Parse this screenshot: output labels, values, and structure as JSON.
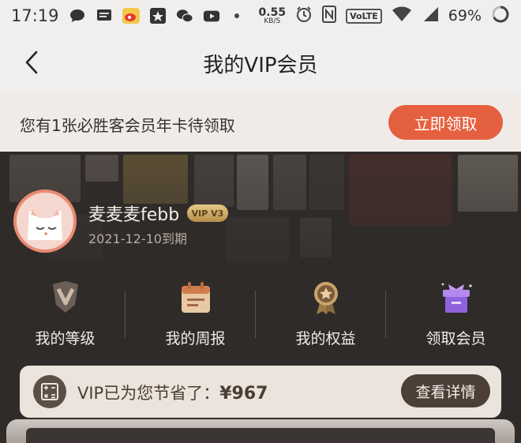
{
  "status_bar": {
    "time": "17:19",
    "net_speed_value": "0.55",
    "net_speed_unit": "KB/S",
    "volte": "VoLTE",
    "battery": "69%",
    "icons": [
      "chat-bubble-icon",
      "message-icon",
      "weibo-icon",
      "star-app-icon",
      "wechat-icon",
      "youtube-icon",
      "alarm-icon",
      "nfc-icon",
      "wifi-icon",
      "signal-icon",
      "battery-ring-icon"
    ]
  },
  "nav": {
    "title": "我的VIP会员",
    "back_icon": "chevron-left-icon"
  },
  "promo": {
    "text": "您有1张必胜客会员年卡待领取",
    "button": "立即领取"
  },
  "profile": {
    "username": "麦麦麦febb",
    "vip_badge": "VIP V3",
    "expiry": "2021-12-10到期"
  },
  "features": [
    {
      "label": "我的等级",
      "icon": "v-shield-icon"
    },
    {
      "label": "我的周报",
      "icon": "calendar-report-icon"
    },
    {
      "label": "我的权益",
      "icon": "star-medal-icon"
    },
    {
      "label": "领取会员",
      "icon": "gift-box-icon"
    }
  ],
  "savings": {
    "prefix": "VIP已为您节省了：",
    "amount": "¥967",
    "button": "查看详情",
    "icon": "calculator-icon"
  },
  "colors": {
    "accent": "#e5603f",
    "dark_card": "#2f2b29",
    "gold": "#c9a45a",
    "purple_gift": "#9b6fe0"
  }
}
